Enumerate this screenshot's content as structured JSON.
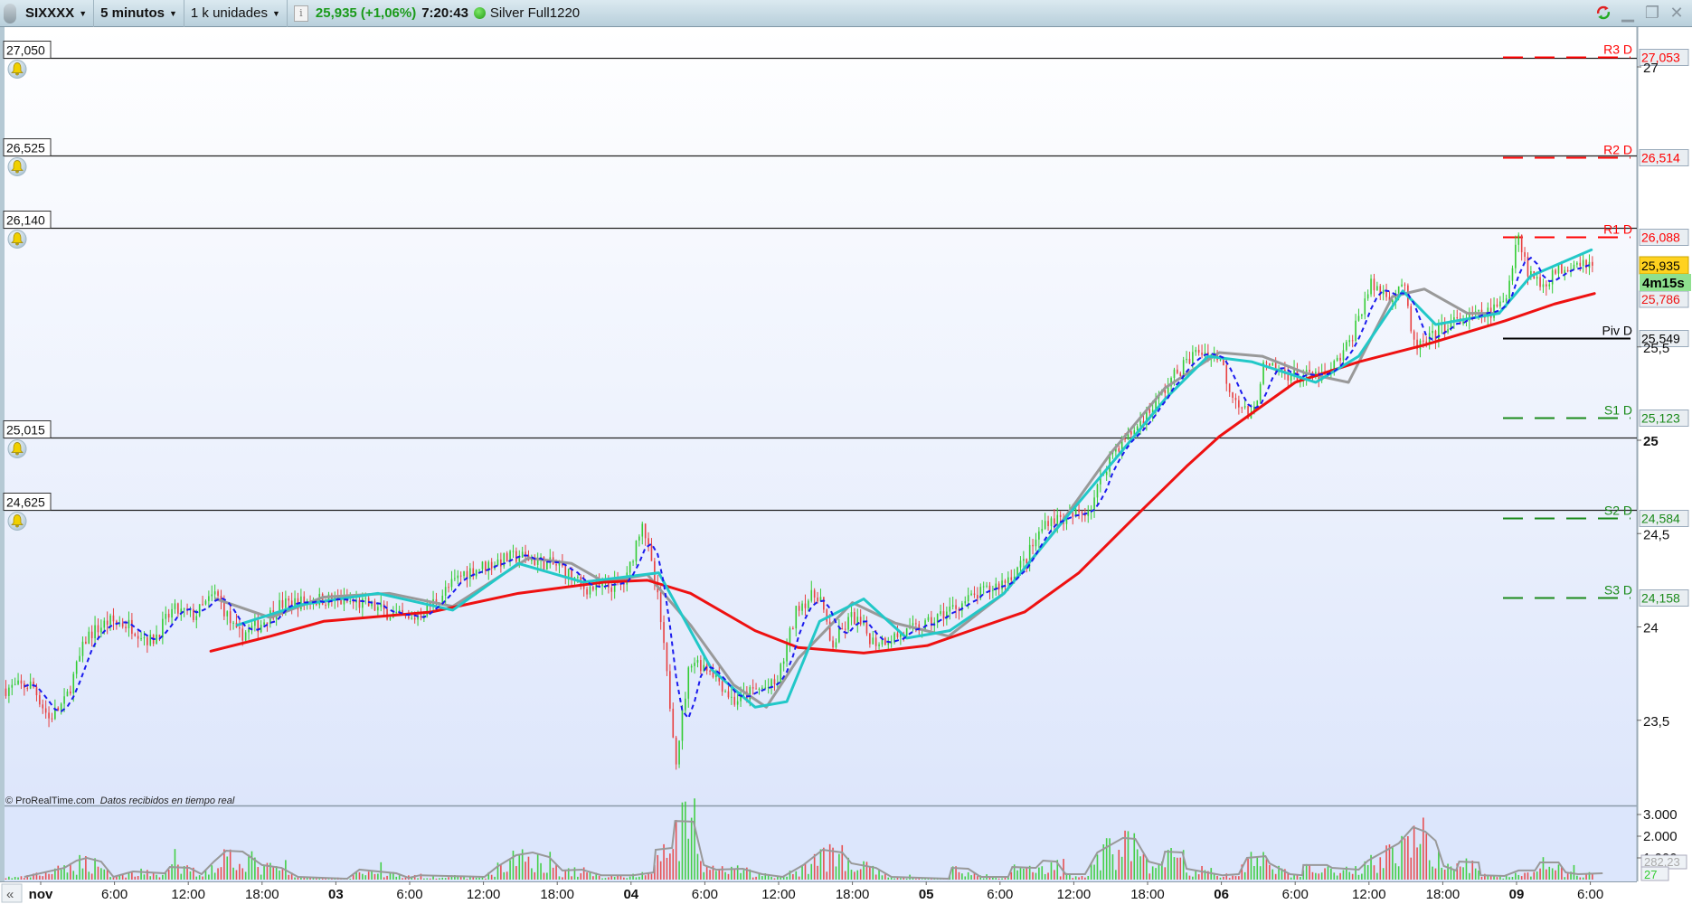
{
  "toolbar": {
    "instrument": "SIXXXX",
    "timeframe": "5 minutos",
    "units": "1 k unidades",
    "price_change": "25,935 (+1,06%)",
    "clock": "7:20:43",
    "account": "Silver Full1220"
  },
  "alerts": [
    {
      "label": "27,050",
      "value": 27.05
    },
    {
      "label": "26,525",
      "value": 26.525
    },
    {
      "label": "26,140",
      "value": 26.14
    },
    {
      "label": "25,015",
      "value": 25.015
    },
    {
      "label": "24,625",
      "value": 24.625
    }
  ],
  "pivots": [
    {
      "name": "R3 D",
      "label": "27,053",
      "value": 27.053,
      "color": "#ff0000",
      "style": "dashed"
    },
    {
      "name": "R2 D",
      "label": "26,514",
      "value": 26.514,
      "color": "#ff0000",
      "style": "dashed"
    },
    {
      "name": "R1 D",
      "label": "26,088",
      "value": 26.088,
      "color": "#ff0000",
      "style": "dashed"
    },
    {
      "name": "Piv D",
      "label": "25,549",
      "value": 25.549,
      "color": "#000000",
      "style": "solid"
    },
    {
      "name": "S1 D",
      "label": "25,123",
      "value": 25.123,
      "color": "#1a8a1a",
      "style": "dashed"
    },
    {
      "name": "S2 D",
      "label": "24,584",
      "value": 24.584,
      "color": "#1a8a1a",
      "style": "dashed"
    },
    {
      "name": "S3 D",
      "label": "24,158",
      "value": 24.158,
      "color": "#1a8a1a",
      "style": "dashed"
    }
  ],
  "price_tags": {
    "last_price": "25,935",
    "countdown": "4m15s",
    "ma_value": "25,786"
  },
  "volume_tags": {
    "avg_value": "282,23",
    "last_volume": "27"
  },
  "footer": {
    "copyright": "© ProRealTime.com",
    "realtime_note": "Datos recibidos en tiempo real"
  },
  "colors": {
    "up": "#33cc33",
    "down": "#e84040",
    "ma_red": "#ee1111",
    "ma_cyan": "#22c8c8",
    "ma_gray": "#999999",
    "signal_blue": "#1a1aee"
  },
  "chart_data": {
    "type": "line",
    "title": "",
    "price_axis": {
      "range": [
        23.2,
        27.2
      ],
      "ticks": [
        {
          "label": "27",
          "value": 27,
          "bold": false
        },
        {
          "label": "25,5",
          "value": 25.5,
          "bold": false
        },
        {
          "label": "25",
          "value": 25,
          "bold": true
        },
        {
          "label": "24,5",
          "value": 24.5,
          "bold": false
        },
        {
          "label": "24",
          "value": 24,
          "bold": false
        },
        {
          "label": "23,5",
          "value": 23.5,
          "bold": false
        }
      ]
    },
    "volume_axis": {
      "ticks": [
        {
          "label": "3.000",
          "value": 3000
        },
        {
          "label": "2.000",
          "value": 2000
        },
        {
          "label": "1.000",
          "value": 1000
        }
      ]
    },
    "time_axis": [
      {
        "label": "nov",
        "time": "02 00:00",
        "bold": true
      },
      {
        "label": "6:00",
        "time": "02 06:00",
        "bold": false
      },
      {
        "label": "12:00",
        "time": "02 12:00",
        "bold": false
      },
      {
        "label": "18:00",
        "time": "02 18:00",
        "bold": false
      },
      {
        "label": "03",
        "time": "03 00:00",
        "bold": true
      },
      {
        "label": "6:00",
        "time": "03 06:00",
        "bold": false
      },
      {
        "label": "12:00",
        "time": "03 12:00",
        "bold": false
      },
      {
        "label": "18:00",
        "time": "03 18:00",
        "bold": false
      },
      {
        "label": "04",
        "time": "04 00:00",
        "bold": true
      },
      {
        "label": "6:00",
        "time": "04 06:00",
        "bold": false
      },
      {
        "label": "12:00",
        "time": "04 12:00",
        "bold": false
      },
      {
        "label": "18:00",
        "time": "04 18:00",
        "bold": false
      },
      {
        "label": "05",
        "time": "05 00:00",
        "bold": true
      },
      {
        "label": "6:00",
        "time": "05 06:00",
        "bold": false
      },
      {
        "label": "12:00",
        "time": "05 12:00",
        "bold": false
      },
      {
        "label": "18:00",
        "time": "05 18:00",
        "bold": false
      },
      {
        "label": "06",
        "time": "06 00:00",
        "bold": true
      },
      {
        "label": "6:00",
        "time": "06 06:00",
        "bold": false
      },
      {
        "label": "12:00",
        "time": "06 12:00",
        "bold": false
      },
      {
        "label": "18:00",
        "time": "06 18:00",
        "bold": false
      },
      {
        "label": "09",
        "time": "09 00:00",
        "bold": true
      },
      {
        "label": "6:00",
        "time": "09 06:00",
        "bold": false
      }
    ],
    "price": [
      [
        "01 21:10",
        23.67
      ],
      [
        "01 23:20",
        23.69
      ],
      [
        "02 00:40",
        23.51
      ],
      [
        "02 02:00",
        23.6
      ],
      [
        "02 03:45",
        23.95
      ],
      [
        "02 05:30",
        24.03
      ],
      [
        "02 07:15",
        24.01
      ],
      [
        "02 09:00",
        23.92
      ],
      [
        "02 10:45",
        24.09
      ],
      [
        "02 12:30",
        24.06
      ],
      [
        "02 14:15",
        24.18
      ],
      [
        "02 16:00",
        23.95
      ],
      [
        "02 17:45",
        24.01
      ],
      [
        "02 19:30",
        24.12
      ],
      [
        "02 23:00",
        24.15
      ],
      [
        "03 02:30",
        24.12
      ],
      [
        "03 06:00",
        24.03
      ],
      [
        "03 07:45",
        24.12
      ],
      [
        "03 10:25",
        24.29
      ],
      [
        "03 13:05",
        24.35
      ],
      [
        "03 14:50",
        24.38
      ],
      [
        "03 18:20",
        24.32
      ],
      [
        "03 20:05",
        24.21
      ],
      [
        "03 21:50",
        24.21
      ],
      [
        "03 23:35",
        24.24
      ],
      [
        "04 00:55",
        24.58
      ],
      [
        "04 02:15",
        24.12
      ],
      [
        "04 03:40",
        23.3
      ],
      [
        "04 04:50",
        23.83
      ],
      [
        "04 06:35",
        23.77
      ],
      [
        "04 08:20",
        23.6
      ],
      [
        "04 10:05",
        23.66
      ],
      [
        "04 11:50",
        23.69
      ],
      [
        "04 13:35",
        24.12
      ],
      [
        "04 15:20",
        24.18
      ],
      [
        "04 16:15",
        23.89
      ],
      [
        "04 18:00",
        24.06
      ],
      [
        "04 19:45",
        23.92
      ],
      [
        "04 21:30",
        23.95
      ],
      [
        "05 00:05",
        24.01
      ],
      [
        "05 01:50",
        24.09
      ],
      [
        "05 03:35",
        24.15
      ],
      [
        "05 06:15",
        24.24
      ],
      [
        "05 08:00",
        24.35
      ],
      [
        "05 09:50",
        24.58
      ],
      [
        "05 11:30",
        24.58
      ],
      [
        "05 13:20",
        24.64
      ],
      [
        "05 15:00",
        24.93
      ],
      [
        "05 16:50",
        25.05
      ],
      [
        "05 18:30",
        25.19
      ],
      [
        "05 20:20",
        25.36
      ],
      [
        "05 22:05",
        25.48
      ],
      [
        "05 23:50",
        25.45
      ],
      [
        "06 00:40",
        25.28
      ],
      [
        "06 02:30",
        25.1
      ],
      [
        "06 03:20",
        25.39
      ],
      [
        "06 05:05",
        25.36
      ],
      [
        "06 06:50",
        25.34
      ],
      [
        "06 08:35",
        25.34
      ],
      [
        "06 10:20",
        25.51
      ],
      [
        "06 12:05",
        25.83
      ],
      [
        "06 13:55",
        25.77
      ],
      [
        "06 14:45",
        25.86
      ],
      [
        "06 15:35",
        25.51
      ],
      [
        "06 16:30",
        25.51
      ],
      [
        "06 18:15",
        25.62
      ],
      [
        "06 20:00",
        25.65
      ],
      [
        "06 21:45",
        25.68
      ],
      [
        "06 23:05",
        25.74
      ],
      [
        "09 00:05",
        26.12
      ],
      [
        "09 00:55",
        25.91
      ],
      [
        "09 02:00",
        25.83
      ],
      [
        "09 03:20",
        25.91
      ],
      [
        "09 05:05",
        25.97
      ],
      [
        "09 06:20",
        25.935
      ]
    ],
    "series": [
      {
        "key": "ma_red",
        "points": [
          [
            "02 13:50",
            23.87
          ],
          [
            "02 18:40",
            23.95
          ],
          [
            "02 23:00",
            24.03
          ],
          [
            "03 07:45",
            24.08
          ],
          [
            "03 14:50",
            24.18
          ],
          [
            "03 21:50",
            24.24
          ],
          [
            "04 01:20",
            24.25
          ],
          [
            "04 04:50",
            24.18
          ],
          [
            "04 10:05",
            23.98
          ],
          [
            "04 13:35",
            23.89
          ],
          [
            "04 18:55",
            23.86
          ],
          [
            "05 00:05",
            23.9
          ],
          [
            "05 03:35",
            23.98
          ],
          [
            "05 08:00",
            24.08
          ],
          [
            "05 12:25",
            24.29
          ],
          [
            "05 16:50",
            24.58
          ],
          [
            "05 21:10",
            24.86
          ],
          [
            "05 23:50",
            25.02
          ],
          [
            "06 06:00",
            25.31
          ],
          [
            "06 11:10",
            25.42
          ],
          [
            "06 16:30",
            25.51
          ],
          [
            "06 23:05",
            25.64
          ],
          [
            "09 03:05",
            25.73
          ],
          [
            "09 06:20",
            25.786
          ]
        ]
      },
      {
        "key": "ma_cyan",
        "points": [
          [
            "02 16:00",
            24.01
          ],
          [
            "02 21:15",
            24.12
          ],
          [
            "03 03:25",
            24.18
          ],
          [
            "03 09:30",
            24.09
          ],
          [
            "03 14:50",
            24.34
          ],
          [
            "03 20:05",
            24.24
          ],
          [
            "04 02:15",
            24.29
          ],
          [
            "04 06:35",
            23.77
          ],
          [
            "04 10:05",
            23.57
          ],
          [
            "04 12:40",
            23.6
          ],
          [
            "04 15:20",
            24.03
          ],
          [
            "04 18:55",
            24.15
          ],
          [
            "04 22:25",
            23.94
          ],
          [
            "05 01:55",
            23.98
          ],
          [
            "05 06:20",
            24.18
          ],
          [
            "05 10:40",
            24.53
          ],
          [
            "05 15:00",
            24.87
          ],
          [
            "05 19:25",
            25.22
          ],
          [
            "05 22:55",
            25.45
          ],
          [
            "06 02:30",
            25.42
          ],
          [
            "06 07:40",
            25.31
          ],
          [
            "06 11:10",
            25.45
          ],
          [
            "06 14:45",
            25.8
          ],
          [
            "06 17:25",
            25.62
          ],
          [
            "06 22:35",
            25.68
          ],
          [
            "09 01:10",
            25.88
          ],
          [
            "09 06:05",
            26.02
          ]
        ]
      },
      {
        "key": "ma_gray",
        "points": [
          [
            "02 14:15",
            24.15
          ],
          [
            "02 18:40",
            24.05
          ],
          [
            "02 23:00",
            24.16
          ],
          [
            "03 04:20",
            24.18
          ],
          [
            "03 09:30",
            24.11
          ],
          [
            "03 15:40",
            24.37
          ],
          [
            "03 19:10",
            24.34
          ],
          [
            "03 21:50",
            24.24
          ],
          [
            "04 01:20",
            24.28
          ],
          [
            "04 04:50",
            24.01
          ],
          [
            "04 08:20",
            23.69
          ],
          [
            "04 11:00",
            23.57
          ],
          [
            "04 13:35",
            23.83
          ],
          [
            "04 18:00",
            24.13
          ],
          [
            "04 21:30",
            24.02
          ],
          [
            "05 01:50",
            23.95
          ],
          [
            "05 06:20",
            24.18
          ],
          [
            "05 10:40",
            24.53
          ],
          [
            "05 15:00",
            24.93
          ],
          [
            "05 19:25",
            25.28
          ],
          [
            "05 23:50",
            25.47
          ],
          [
            "06 03:20",
            25.45
          ],
          [
            "06 06:50",
            25.36
          ],
          [
            "06 10:20",
            25.31
          ],
          [
            "06 13:55",
            25.77
          ],
          [
            "06 16:30",
            25.81
          ],
          [
            "06 20:00",
            25.68
          ],
          [
            "06 22:35",
            25.68
          ]
        ]
      }
    ],
    "volume_avg": [
      [
        "01 22:40",
        125
      ],
      [
        "02 01:55",
        540
      ],
      [
        "02 02:55",
        875
      ],
      [
        "02 03:45",
        1000
      ],
      [
        "02 04:55",
        830
      ],
      [
        "02 05:55",
        125
      ],
      [
        "02 07:30",
        375
      ],
      [
        "02 10:05",
        290
      ],
      [
        "02 10:30",
        580
      ],
      [
        "02 12:05",
        540
      ],
      [
        "02 13:05",
        250
      ],
      [
        "02 14:05",
        830
      ],
      [
        "02 15:05",
        1330
      ],
      [
        "02 16:25",
        1290
      ],
      [
        "02 18:00",
        670
      ],
      [
        "02 19:35",
        540
      ],
      [
        "02 20:55",
        125
      ],
      [
        "03 00:55",
        40
      ],
      [
        "03 01:55",
        460
      ],
      [
        "03 04:55",
        290
      ],
      [
        "03 05:55",
        80
      ],
      [
        "03 06:50",
        200
      ],
      [
        "03 12:05",
        125
      ],
      [
        "03 13:05",
        580
      ],
      [
        "03 14:40",
        1125
      ],
      [
        "03 16:00",
        1250
      ],
      [
        "03 17:20",
        1040
      ],
      [
        "03 18:25",
        420
      ],
      [
        "03 20:00",
        460
      ],
      [
        "03 21:35",
        200
      ],
      [
        "04 00:10",
        200
      ],
      [
        "04 01:50",
        330
      ],
      [
        "04 02:00",
        1375
      ],
      [
        "04 03:20",
        1460
      ],
      [
        "04 03:35",
        2700
      ],
      [
        "04 05:05",
        2670
      ],
      [
        "04 05:55",
        670
      ],
      [
        "04 06:55",
        460
      ],
      [
        "04 09:05",
        500
      ],
      [
        "04 10:40",
        250
      ],
      [
        "04 12:20",
        125
      ],
      [
        "04 14:00",
        670
      ],
      [
        "04 15:35",
        1375
      ],
      [
        "04 17:10",
        1250
      ],
      [
        "04 17:55",
        750
      ],
      [
        "04 19:55",
        540
      ],
      [
        "04 21:10",
        125
      ],
      [
        "05 01:50",
        40
      ],
      [
        "05 02:05",
        540
      ],
      [
        "05 03:25",
        500
      ],
      [
        "05 04:25",
        125
      ],
      [
        "05 06:40",
        125
      ],
      [
        "05 07:00",
        580
      ],
      [
        "05 08:55",
        540
      ],
      [
        "05 09:30",
        875
      ],
      [
        "05 10:35",
        830
      ],
      [
        "05 11:20",
        250
      ],
      [
        "05 12:55",
        250
      ],
      [
        "05 13:55",
        1250
      ],
      [
        "05 16:00",
        1920
      ],
      [
        "05 17:00",
        1875
      ],
      [
        "05 18:05",
        830
      ],
      [
        "05 19:10",
        670
      ],
      [
        "05 19:25",
        1290
      ],
      [
        "05 20:50",
        1250
      ],
      [
        "05 21:10",
        500
      ],
      [
        "06 00:05",
        200
      ],
      [
        "06 01:25",
        250
      ],
      [
        "06 02:05",
        1000
      ],
      [
        "06 03:35",
        1080
      ],
      [
        "06 03:55",
        750
      ],
      [
        "06 05:35",
        250
      ],
      [
        "06 06:35",
        200
      ],
      [
        "06 06:40",
        670
      ],
      [
        "06 08:35",
        670
      ],
      [
        "06 09:00",
        540
      ],
      [
        "06 11:10",
        460
      ],
      [
        "06 11:55",
        875
      ],
      [
        "06 14:25",
        1670
      ],
      [
        "06 15:35",
        2420
      ],
      [
        "06 16:35",
        2210
      ],
      [
        "06 17:25",
        1790
      ],
      [
        "06 18:05",
        625
      ],
      [
        "06 19:05",
        420
      ],
      [
        "06 19:20",
        830
      ],
      [
        "06 20:55",
        790
      ],
      [
        "06 21:05",
        200
      ],
      [
        "06 23:00",
        165
      ],
      [
        "09 00:10",
        420
      ],
      [
        "09 01:30",
        420
      ],
      [
        "09 01:55",
        790
      ],
      [
        "09 03:25",
        790
      ],
      [
        "09 04:00",
        330
      ],
      [
        "09 05:00",
        250
      ],
      [
        "09 07:00",
        290
      ]
    ]
  }
}
